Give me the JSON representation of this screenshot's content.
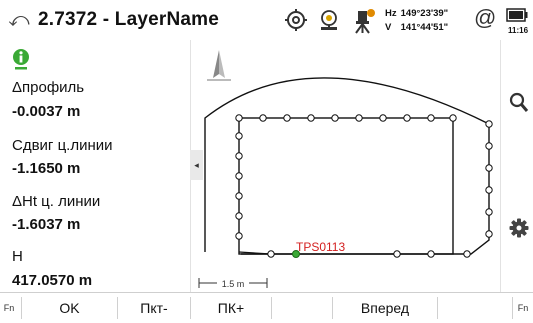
{
  "titlebar": {
    "back_glyph": "⤺",
    "title": "2.7372 - LayerName",
    "hz_label": "Hz",
    "hz_value": "149°23'39\"",
    "v_label": "V",
    "v_value": "141°44'51\"",
    "at_glyph": "@",
    "time": "11:16"
  },
  "panel": {
    "dprofile_label": "Δпрофиль",
    "dprofile_value": "-0.0037 m",
    "shift_label": "Сдвиг ц.линии",
    "shift_value": "-1.1650 m",
    "dht_label": "ΔHt ц. линии",
    "dht_value": "-1.6037 m",
    "h_label": "H",
    "h_value": "417.0570 m"
  },
  "map": {
    "point_label": "TPS0113",
    "scale_label": "1.5 m",
    "collapse_glyph": "◂"
  },
  "bottom": {
    "fn_left": "Fn",
    "ok": "OK",
    "prev_point": "Пкт-",
    "pk_plus": "ПК+",
    "forward": "Вперед",
    "fn_right": "Fn"
  },
  "colors": {
    "accent_green": "#3aa935",
    "target_red": "#d42020",
    "battery_dark": "#222222"
  }
}
